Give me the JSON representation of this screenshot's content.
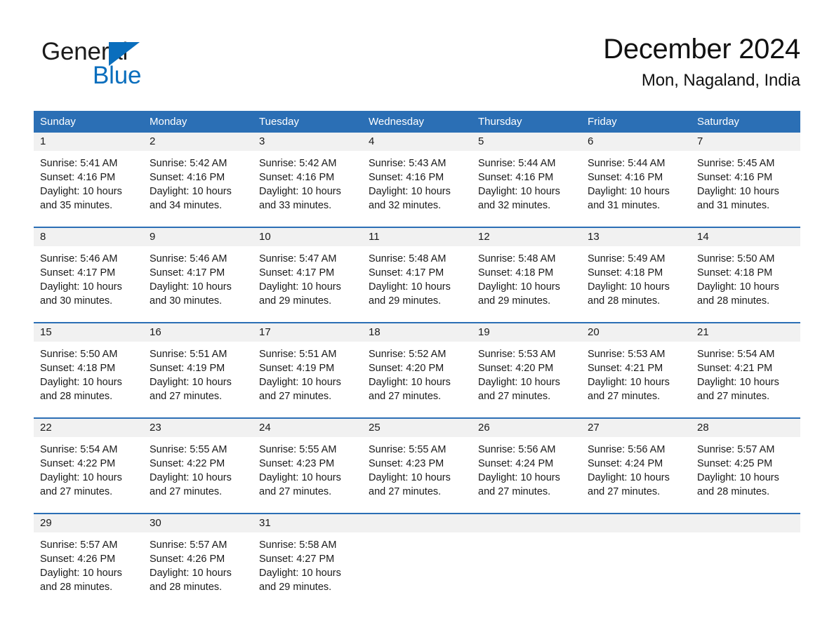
{
  "brand": {
    "name_part1": "General",
    "name_part2": "Blue",
    "triangle_color": "#0a6ebd"
  },
  "header": {
    "title": "December 2024",
    "subtitle": "Mon, Nagaland, India"
  },
  "colors": {
    "header_blue": "#2b6fb5",
    "daynum_band": "#f1f1f1",
    "text": "#1a1a1a"
  },
  "weekdays": [
    "Sunday",
    "Monday",
    "Tuesday",
    "Wednesday",
    "Thursday",
    "Friday",
    "Saturday"
  ],
  "weeks": [
    {
      "days": [
        {
          "num": "1",
          "sunrise": "Sunrise: 5:41 AM",
          "sunset": "Sunset: 4:16 PM",
          "daylight1": "Daylight: 10 hours",
          "daylight2": "and 35 minutes."
        },
        {
          "num": "2",
          "sunrise": "Sunrise: 5:42 AM",
          "sunset": "Sunset: 4:16 PM",
          "daylight1": "Daylight: 10 hours",
          "daylight2": "and 34 minutes."
        },
        {
          "num": "3",
          "sunrise": "Sunrise: 5:42 AM",
          "sunset": "Sunset: 4:16 PM",
          "daylight1": "Daylight: 10 hours",
          "daylight2": "and 33 minutes."
        },
        {
          "num": "4",
          "sunrise": "Sunrise: 5:43 AM",
          "sunset": "Sunset: 4:16 PM",
          "daylight1": "Daylight: 10 hours",
          "daylight2": "and 32 minutes."
        },
        {
          "num": "5",
          "sunrise": "Sunrise: 5:44 AM",
          "sunset": "Sunset: 4:16 PM",
          "daylight1": "Daylight: 10 hours",
          "daylight2": "and 32 minutes."
        },
        {
          "num": "6",
          "sunrise": "Sunrise: 5:44 AM",
          "sunset": "Sunset: 4:16 PM",
          "daylight1": "Daylight: 10 hours",
          "daylight2": "and 31 minutes."
        },
        {
          "num": "7",
          "sunrise": "Sunrise: 5:45 AM",
          "sunset": "Sunset: 4:16 PM",
          "daylight1": "Daylight: 10 hours",
          "daylight2": "and 31 minutes."
        }
      ]
    },
    {
      "days": [
        {
          "num": "8",
          "sunrise": "Sunrise: 5:46 AM",
          "sunset": "Sunset: 4:17 PM",
          "daylight1": "Daylight: 10 hours",
          "daylight2": "and 30 minutes."
        },
        {
          "num": "9",
          "sunrise": "Sunrise: 5:46 AM",
          "sunset": "Sunset: 4:17 PM",
          "daylight1": "Daylight: 10 hours",
          "daylight2": "and 30 minutes."
        },
        {
          "num": "10",
          "sunrise": "Sunrise: 5:47 AM",
          "sunset": "Sunset: 4:17 PM",
          "daylight1": "Daylight: 10 hours",
          "daylight2": "and 29 minutes."
        },
        {
          "num": "11",
          "sunrise": "Sunrise: 5:48 AM",
          "sunset": "Sunset: 4:17 PM",
          "daylight1": "Daylight: 10 hours",
          "daylight2": "and 29 minutes."
        },
        {
          "num": "12",
          "sunrise": "Sunrise: 5:48 AM",
          "sunset": "Sunset: 4:18 PM",
          "daylight1": "Daylight: 10 hours",
          "daylight2": "and 29 minutes."
        },
        {
          "num": "13",
          "sunrise": "Sunrise: 5:49 AM",
          "sunset": "Sunset: 4:18 PM",
          "daylight1": "Daylight: 10 hours",
          "daylight2": "and 28 minutes."
        },
        {
          "num": "14",
          "sunrise": "Sunrise: 5:50 AM",
          "sunset": "Sunset: 4:18 PM",
          "daylight1": "Daylight: 10 hours",
          "daylight2": "and 28 minutes."
        }
      ]
    },
    {
      "days": [
        {
          "num": "15",
          "sunrise": "Sunrise: 5:50 AM",
          "sunset": "Sunset: 4:18 PM",
          "daylight1": "Daylight: 10 hours",
          "daylight2": "and 28 minutes."
        },
        {
          "num": "16",
          "sunrise": "Sunrise: 5:51 AM",
          "sunset": "Sunset: 4:19 PM",
          "daylight1": "Daylight: 10 hours",
          "daylight2": "and 27 minutes."
        },
        {
          "num": "17",
          "sunrise": "Sunrise: 5:51 AM",
          "sunset": "Sunset: 4:19 PM",
          "daylight1": "Daylight: 10 hours",
          "daylight2": "and 27 minutes."
        },
        {
          "num": "18",
          "sunrise": "Sunrise: 5:52 AM",
          "sunset": "Sunset: 4:20 PM",
          "daylight1": "Daylight: 10 hours",
          "daylight2": "and 27 minutes."
        },
        {
          "num": "19",
          "sunrise": "Sunrise: 5:53 AM",
          "sunset": "Sunset: 4:20 PM",
          "daylight1": "Daylight: 10 hours",
          "daylight2": "and 27 minutes."
        },
        {
          "num": "20",
          "sunrise": "Sunrise: 5:53 AM",
          "sunset": "Sunset: 4:21 PM",
          "daylight1": "Daylight: 10 hours",
          "daylight2": "and 27 minutes."
        },
        {
          "num": "21",
          "sunrise": "Sunrise: 5:54 AM",
          "sunset": "Sunset: 4:21 PM",
          "daylight1": "Daylight: 10 hours",
          "daylight2": "and 27 minutes."
        }
      ]
    },
    {
      "days": [
        {
          "num": "22",
          "sunrise": "Sunrise: 5:54 AM",
          "sunset": "Sunset: 4:22 PM",
          "daylight1": "Daylight: 10 hours",
          "daylight2": "and 27 minutes."
        },
        {
          "num": "23",
          "sunrise": "Sunrise: 5:55 AM",
          "sunset": "Sunset: 4:22 PM",
          "daylight1": "Daylight: 10 hours",
          "daylight2": "and 27 minutes."
        },
        {
          "num": "24",
          "sunrise": "Sunrise: 5:55 AM",
          "sunset": "Sunset: 4:23 PM",
          "daylight1": "Daylight: 10 hours",
          "daylight2": "and 27 minutes."
        },
        {
          "num": "25",
          "sunrise": "Sunrise: 5:55 AM",
          "sunset": "Sunset: 4:23 PM",
          "daylight1": "Daylight: 10 hours",
          "daylight2": "and 27 minutes."
        },
        {
          "num": "26",
          "sunrise": "Sunrise: 5:56 AM",
          "sunset": "Sunset: 4:24 PM",
          "daylight1": "Daylight: 10 hours",
          "daylight2": "and 27 minutes."
        },
        {
          "num": "27",
          "sunrise": "Sunrise: 5:56 AM",
          "sunset": "Sunset: 4:24 PM",
          "daylight1": "Daylight: 10 hours",
          "daylight2": "and 27 minutes."
        },
        {
          "num": "28",
          "sunrise": "Sunrise: 5:57 AM",
          "sunset": "Sunset: 4:25 PM",
          "daylight1": "Daylight: 10 hours",
          "daylight2": "and 28 minutes."
        }
      ]
    },
    {
      "days": [
        {
          "num": "29",
          "sunrise": "Sunrise: 5:57 AM",
          "sunset": "Sunset: 4:26 PM",
          "daylight1": "Daylight: 10 hours",
          "daylight2": "and 28 minutes."
        },
        {
          "num": "30",
          "sunrise": "Sunrise: 5:57 AM",
          "sunset": "Sunset: 4:26 PM",
          "daylight1": "Daylight: 10 hours",
          "daylight2": "and 28 minutes."
        },
        {
          "num": "31",
          "sunrise": "Sunrise: 5:58 AM",
          "sunset": "Sunset: 4:27 PM",
          "daylight1": "Daylight: 10 hours",
          "daylight2": "and 29 minutes."
        },
        {
          "num": "",
          "sunrise": "",
          "sunset": "",
          "daylight1": "",
          "daylight2": ""
        },
        {
          "num": "",
          "sunrise": "",
          "sunset": "",
          "daylight1": "",
          "daylight2": ""
        },
        {
          "num": "",
          "sunrise": "",
          "sunset": "",
          "daylight1": "",
          "daylight2": ""
        },
        {
          "num": "",
          "sunrise": "",
          "sunset": "",
          "daylight1": "",
          "daylight2": ""
        }
      ]
    }
  ]
}
